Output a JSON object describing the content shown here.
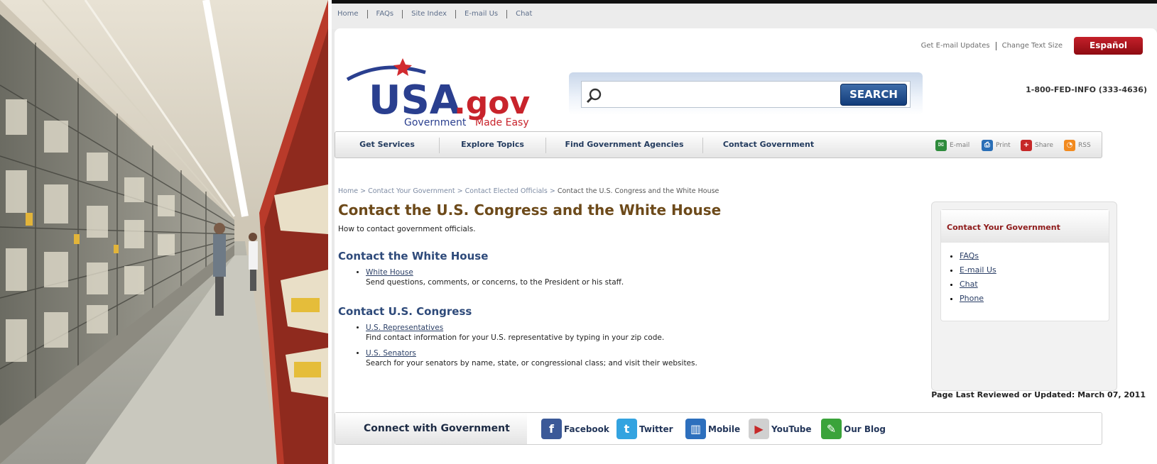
{
  "top_links": [
    "Home",
    "FAQs",
    "Site Index",
    "E-mail Us",
    "Chat"
  ],
  "utility": {
    "email_updates": "Get E-mail Updates",
    "text_size": "Change Text Size",
    "espanol": "Español"
  },
  "logo": {
    "name": "USA",
    "suffix": ".gov",
    "tagline_blue": "Government",
    "tagline_red": "Made Easy"
  },
  "search": {
    "placeholder": "",
    "button_label": "SEARCH"
  },
  "phone": "1-800-FED-INFO (333-4636)",
  "main_nav": [
    "Get Services",
    "Explore Topics",
    "Find Government Agencies",
    "Contact Government"
  ],
  "share_tools": [
    {
      "label": "E-mail",
      "icon": "email-icon",
      "color": "#2e8b3c"
    },
    {
      "label": "Print",
      "icon": "print-icon",
      "color": "#2a6fb7"
    },
    {
      "label": "Share",
      "icon": "share-icon",
      "color": "#c62828"
    },
    {
      "label": "RSS",
      "icon": "rss-icon",
      "color": "#f28a1f"
    }
  ],
  "breadcrumb": {
    "home": "Home",
    "level2": "Contact Your Government",
    "level3": "Contact Elected Officials",
    "current": "Contact the U.S. Congress and the White House"
  },
  "page_title": "Contact the U.S. Congress and the White House",
  "subtitle": "How to contact government officials.",
  "sections": [
    {
      "heading": "Contact the White House",
      "items": [
        {
          "link": "White House",
          "desc": "Send questions, comments, or concerns, to the President or his staff."
        }
      ]
    },
    {
      "heading": "Contact U.S. Congress",
      "items": [
        {
          "link": "U.S. Representatives",
          "desc": "Find contact information for your U.S. representative by typing in your zip code."
        },
        {
          "link": "U.S. Senators",
          "desc": "Search for your senators by name, state, or congressional class; and visit their websites."
        }
      ]
    }
  ],
  "sidebar": {
    "title": "Contact Your Government",
    "links": [
      "FAQs",
      "E-mail Us",
      "Chat",
      "Phone"
    ]
  },
  "last_reviewed": "Page Last Reviewed or Updated: March 07, 2011",
  "connect": {
    "title": "Connect with Government",
    "items": [
      {
        "label": "Facebook",
        "icon": "facebook-icon",
        "color": "#3b5998",
        "glyph": "f"
      },
      {
        "label": "Twitter",
        "icon": "twitter-icon",
        "color": "#33a3e0",
        "glyph": "t"
      },
      {
        "label": "Mobile",
        "icon": "mobile-icon",
        "color": "#2d6fbd",
        "glyph": "▥"
      },
      {
        "label": "YouTube",
        "icon": "youtube-icon",
        "color": "#d0d0d0",
        "glyph": "▶"
      },
      {
        "label": "Our Blog",
        "icon": "blog-icon",
        "color": "#3aa33a",
        "glyph": "✎"
      }
    ]
  },
  "colors": {
    "title_brown": "#6d4a1a",
    "heading_blue": "#2e4a7a",
    "espanol_red": "#b31a22",
    "search_button_blue": "#1f4f8f"
  }
}
